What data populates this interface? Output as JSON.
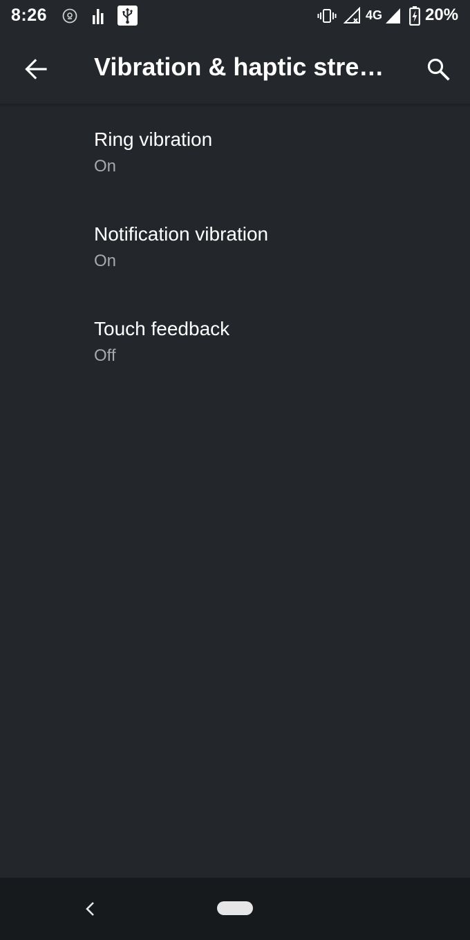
{
  "status_bar": {
    "time": "8:26",
    "network": "4G",
    "battery": "20%",
    "icons": [
      "location-icon",
      "signal-bars-icon",
      "usb-icon",
      "vibrate-icon",
      "no-signal-icon",
      "cell-signal-icon",
      "battery-charging-icon"
    ]
  },
  "app_bar": {
    "title": "Vibration & haptic strength",
    "back_icon": "arrow-back-icon",
    "search_icon": "search-icon"
  },
  "settings": [
    {
      "title": "Ring vibration",
      "summary": "On"
    },
    {
      "title": "Notification vibration",
      "summary": "On"
    },
    {
      "title": "Touch feedback",
      "summary": "Off"
    }
  ],
  "nav_bar": {
    "back_icon": "chevron-left-icon",
    "home_icon": "home-pill-icon"
  },
  "colors": {
    "background": "#23272c",
    "app_bar": "#24282d",
    "nav_bar": "#161a1d",
    "summary_text": "#a7aaad"
  }
}
